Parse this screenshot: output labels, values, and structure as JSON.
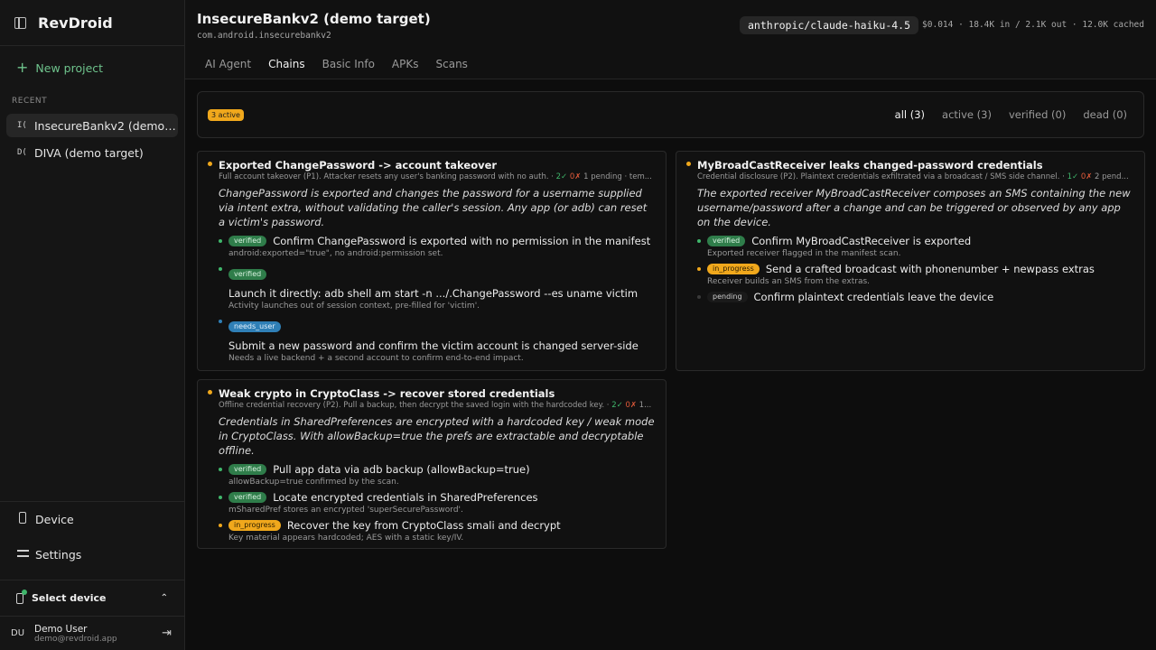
{
  "sidebar": {
    "brand": "RevDroid",
    "new_project": "New project",
    "recent_label": "RECENT",
    "projects": [
      {
        "icon": "I(",
        "label": "InsecureBankv2 (demo t...",
        "active": true
      },
      {
        "icon": "D(",
        "label": "DIVA (demo target)",
        "active": false
      }
    ],
    "nav": [
      {
        "label": "Device",
        "icon": "phone-icon"
      },
      {
        "label": "Settings",
        "icon": "sliders-icon"
      }
    ],
    "select_device": "Select device",
    "user": {
      "initials": "DU",
      "name": "Demo User",
      "email": "demo@revdroid.app"
    }
  },
  "header": {
    "title": "InsecureBankv2 (demo target)",
    "package": "com.android.insecurebankv2",
    "model": "anthropic/claude-haiku-4.5",
    "usage": "$0.014 · 18.4K in / 2.1K out · 12.0K cached",
    "tabs": [
      "AI Agent",
      "Chains",
      "Basic Info",
      "APKs",
      "Scans"
    ],
    "active_tab": "Chains"
  },
  "filterbar": {
    "active_badge": "3 active",
    "filters": [
      "all (3)",
      "active (3)",
      "verified (0)",
      "dead (0)"
    ],
    "active_filter": "all (3)"
  },
  "colors": {
    "accent": "#6ec38c",
    "active": "#f0a81c",
    "verified": "#3fb66b",
    "needs_user": "#2f7fb6",
    "failed": "#e05a3a"
  },
  "chains": [
    {
      "title": "Exported ChangePassword -> account takeover",
      "sub_text": "Full account takeover (P1). Attacker resets any user's banking password with no auth. · ",
      "sub_ok": "2✓",
      "sub_bad": "0✗",
      "sub_rest": " 1 pending · tem...",
      "description": "ChangePassword is exported and changes the password for a username supplied via intent extra, without validating the caller's session. Any app (or adb) can reset a victim's password.",
      "steps": [
        {
          "status": "verified",
          "label": "Confirm ChangePassword is exported with no permission in the manifest",
          "note": "android:exported=\"true\", no android:permission set."
        },
        {
          "status": "verified",
          "label": "Launch it directly: adb shell am start -n .../.ChangePassword --es uname victim",
          "note": "Activity launches out of session context, pre-filled for 'victim'."
        },
        {
          "status": "needs_user",
          "label": "Submit a new password and confirm the victim account is changed server-side",
          "note": "Needs a live backend + a second account to confirm end-to-end impact."
        }
      ]
    },
    {
      "title": "MyBroadCastReceiver leaks changed-password credentials",
      "sub_text": "Credential disclosure (P2). Plaintext credentials exfiltrated via a broadcast / SMS side channel. · ",
      "sub_ok": "1✓",
      "sub_bad": "0✗",
      "sub_rest": " 2 pend...",
      "description": "The exported receiver MyBroadCastReceiver composes an SMS containing the new username/password after a change and can be triggered or observed by any app on the device.",
      "steps": [
        {
          "status": "verified",
          "label": "Confirm MyBroadCastReceiver is exported",
          "note": "Exported receiver flagged in the manifest scan."
        },
        {
          "status": "in_progress",
          "label": "Send a crafted broadcast with phonenumber + newpass extras",
          "note": "Receiver builds an SMS from the extras."
        },
        {
          "status": "pending",
          "label": "Confirm plaintext credentials leave the device",
          "note": ""
        }
      ]
    },
    {
      "title": "Weak crypto in CryptoClass -> recover stored credentials",
      "sub_text": "Offline credential recovery (P2). Pull a backup, then decrypt the saved login with the hardcoded key. · ",
      "sub_ok": "2✓",
      "sub_bad": "0✗",
      "sub_rest": " 1...",
      "description": "Credentials in SharedPreferences are encrypted with a hardcoded key / weak mode in CryptoClass. With allowBackup=true the prefs are extractable and decryptable offline.",
      "steps": [
        {
          "status": "verified",
          "label": "Pull app data via adb backup (allowBackup=true)",
          "note": "allowBackup=true confirmed by the scan."
        },
        {
          "status": "verified",
          "label": "Locate encrypted credentials in SharedPreferences",
          "note": "mSharedPref stores an encrypted 'superSecurePassword'."
        },
        {
          "status": "in_progress",
          "label": "Recover the key from CryptoClass smali and decrypt",
          "note": "Key material appears hardcoded; AES with a static key/IV."
        }
      ]
    }
  ]
}
